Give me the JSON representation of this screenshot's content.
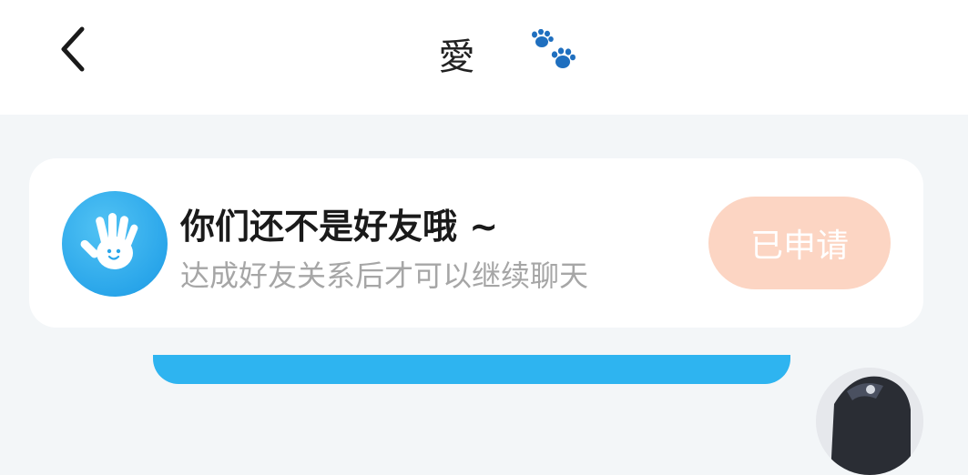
{
  "header": {
    "title": "愛",
    "back_icon": "chevron-left-icon",
    "title_badge_icon": "paw-prints-icon"
  },
  "friend_notice": {
    "icon": "waving-hand-icon",
    "title": "你们还不是好友哦 ~",
    "subtitle": "达成好友关系后才可以继续聊天",
    "button_label": "已申请"
  },
  "colors": {
    "accent_blue": "#2eb4f0",
    "paw_blue": "#1f6fbf",
    "button_disabled": "#fcd5c3",
    "background": "#f3f6f8"
  }
}
